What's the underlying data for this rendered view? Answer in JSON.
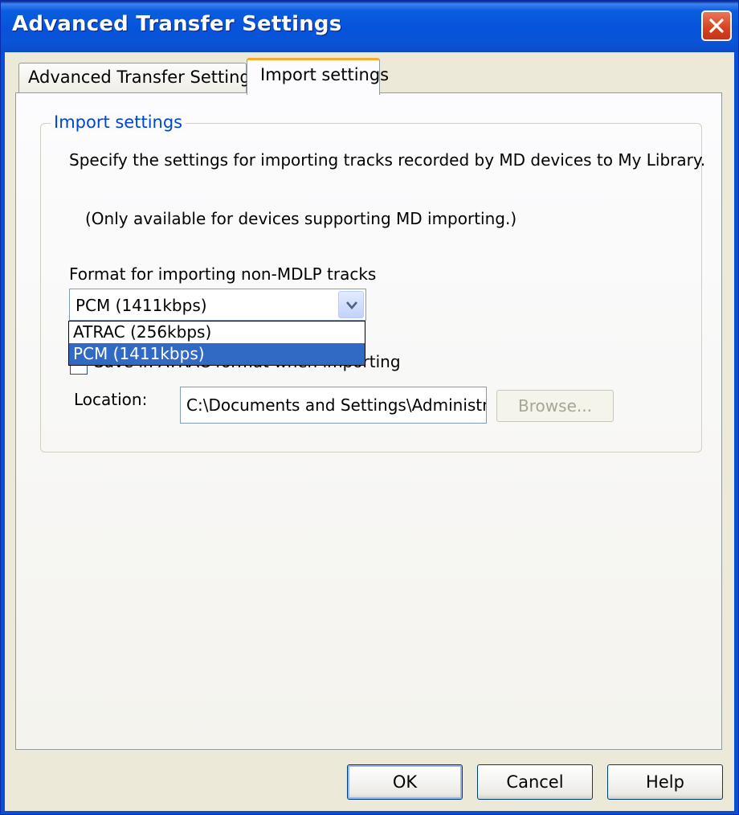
{
  "window": {
    "title": "Advanced Transfer Settings"
  },
  "tabs": [
    {
      "label": "Advanced Transfer Settings",
      "active": false
    },
    {
      "label": "Import settings",
      "active": true
    }
  ],
  "import_settings": {
    "group_title": "Import settings",
    "description": "Specify the settings for importing tracks recorded by MD devices to My Library.",
    "note": "(Only available for devices supporting MD importing.)",
    "format_label": "Format for importing non-MDLP tracks",
    "format_selected": "PCM (1411kbps)",
    "format_options": [
      "ATRAC (256kbps)",
      "PCM (1411kbps)"
    ],
    "highlighted_option": "PCM (1411kbps)",
    "checkbox_label_partial": "Save in ATRAC format when importing",
    "location_label": "Location:",
    "location_value": "C:\\Documents and Settings\\Administra",
    "browse_label": "Browse..."
  },
  "footer": {
    "ok_label": "OK",
    "cancel_label": "Cancel",
    "help_label": "Help"
  },
  "colors": {
    "titlebar": "#0a5ddf",
    "tab_highlight": "#f6a92f",
    "group_title": "#0046d5",
    "selection": "#316ac5"
  }
}
